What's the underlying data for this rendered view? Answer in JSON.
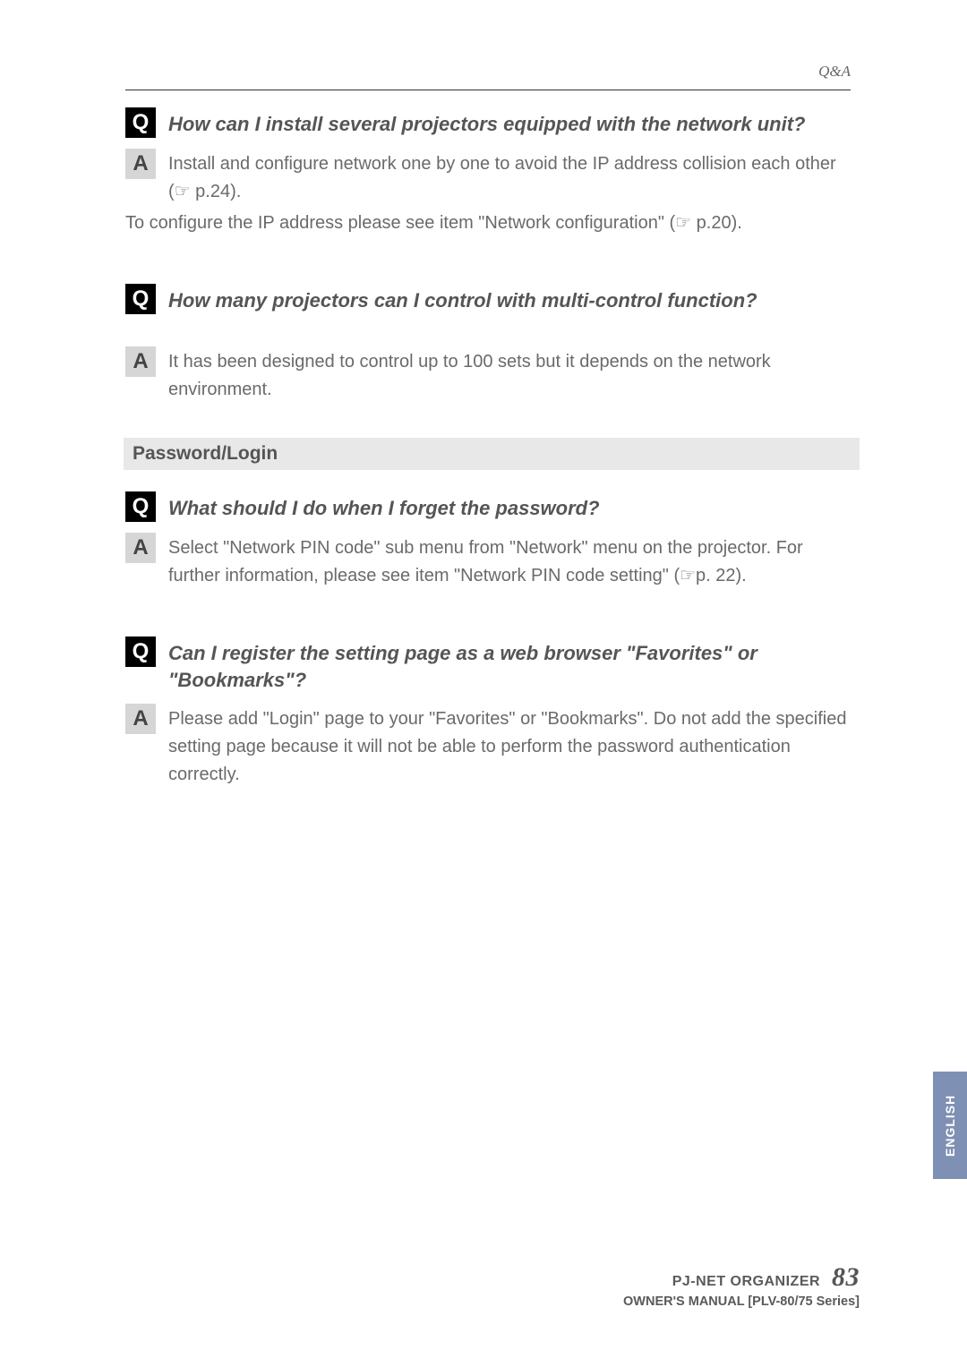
{
  "header": {
    "section_label": "Q&A"
  },
  "qa": [
    {
      "q": "How can I install several projectors equipped with the network unit?",
      "a_main": "Install and configure network one by one to avoid the IP address collision each other (☞ p.24).",
      "a_sub": "To configure the IP address please see item \"Network configuration\" (☞ p.20)."
    },
    {
      "q": "How many projectors can I control with multi-control function?",
      "a_main": "It has been designed to control up to 100 sets but it depends on the network environment."
    }
  ],
  "section_heading": "Password/Login",
  "qa2": [
    {
      "q": "What should I do when I forget the password?",
      "a_main": "Select \"Network PIN code\" sub menu from \"Network\" menu on the projector. For further information, please see item \"Network PIN code setting\" (☞p. 22)."
    },
    {
      "q": "Can I register the setting page as a web browser \"Favorites\" or \"Bookmarks\"?",
      "a_main": "Please add \"Login\" page to your \"Favorites\" or \"Bookmarks\". Do not add the specified setting page because it will not be able to perform the password authentication correctly."
    }
  ],
  "side_tab": "ENGLISH",
  "footer": {
    "title": "PJ-NET ORGANIZER",
    "page_number": "83",
    "subtitle": "OWNER'S MANUAL [PLV-80/75 Series]"
  },
  "labels": {
    "q": "Q",
    "a": "A"
  }
}
